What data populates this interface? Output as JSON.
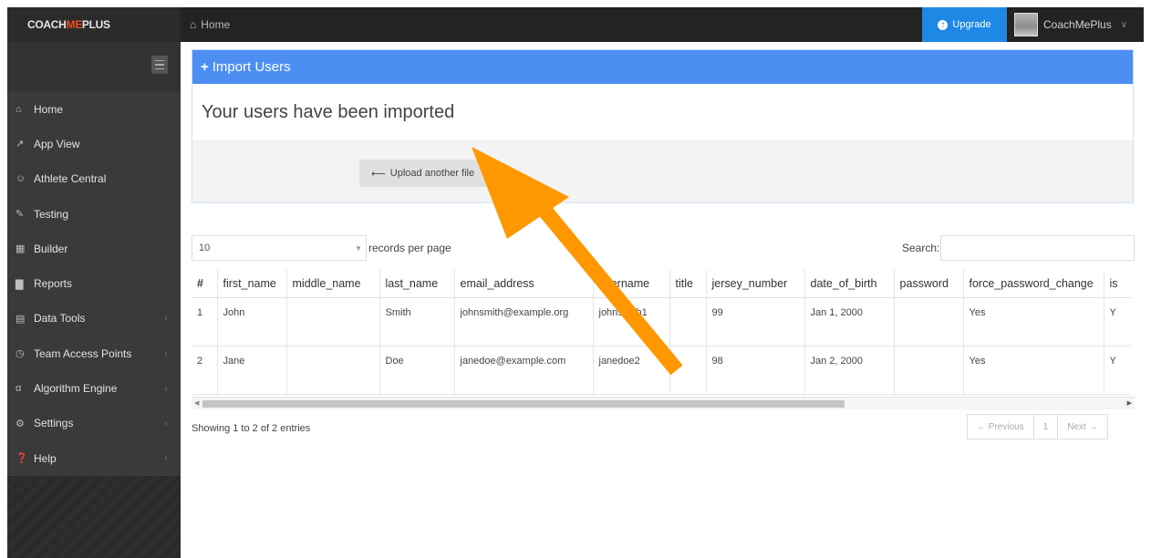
{
  "header": {
    "brand": {
      "part1": "COACH",
      "part2": "ME",
      "part3": "PLUS"
    },
    "breadcrumb": "Home",
    "upgrade_label": "Upgrade",
    "user_name": "CoachMePlus"
  },
  "sidebar": {
    "items": [
      {
        "label": "Home",
        "icon": "home-icon",
        "has_arrow": false
      },
      {
        "label": "App View",
        "icon": "external-link-icon",
        "has_arrow": false
      },
      {
        "label": "Athlete Central",
        "icon": "users-icon",
        "has_arrow": false
      },
      {
        "label": "Testing",
        "icon": "edit-icon",
        "has_arrow": false
      },
      {
        "label": "Builder",
        "icon": "calendar-icon",
        "has_arrow": false
      },
      {
        "label": "Reports",
        "icon": "bar-chart-icon",
        "has_arrow": false
      },
      {
        "label": "Data Tools",
        "icon": "table-icon",
        "has_arrow": true
      },
      {
        "label": "Team Access Points",
        "icon": "clock-icon",
        "has_arrow": true
      },
      {
        "label": "Algorithm Engine",
        "icon": "algorithm-icon",
        "has_arrow": true
      },
      {
        "label": "Settings",
        "icon": "cogs-icon",
        "has_arrow": true
      },
      {
        "label": "Help",
        "icon": "question-circle-icon",
        "has_arrow": true
      }
    ]
  },
  "panel": {
    "heading": "Import Users",
    "message": "Your users have been imported",
    "upload_button": "Upload another file"
  },
  "table_controls": {
    "page_length": "10",
    "page_length_suffix": "records per page",
    "search_label": "Search:",
    "search_value": ""
  },
  "table": {
    "columns": [
      "#",
      "first_name",
      "middle_name",
      "last_name",
      "email_address",
      "username",
      "title",
      "jersey_number",
      "date_of_birth",
      "password",
      "force_password_change",
      "is"
    ],
    "rows": [
      [
        "1",
        "John",
        "",
        "Smith",
        "johnsmith@example.org",
        "johnsmith1",
        "",
        "99",
        "Jan 1, 2000",
        "",
        "Yes",
        "Y"
      ],
      [
        "2",
        "Jane",
        "",
        "Doe",
        "janedoe@example.com",
        "janedoe2",
        "",
        "98",
        "Jan 2, 2000",
        "",
        "Yes",
        "Y"
      ]
    ]
  },
  "footer": {
    "info": "Showing 1 to 2 of 2 entries",
    "previous": "← Previous",
    "page": "1",
    "next": "Next →"
  },
  "colors": {
    "panel_header": "#4d8ef3",
    "upgrade": "#1e88e5",
    "annotation_arrow": "#ff9800",
    "brand_accent": "#ee4d26"
  }
}
